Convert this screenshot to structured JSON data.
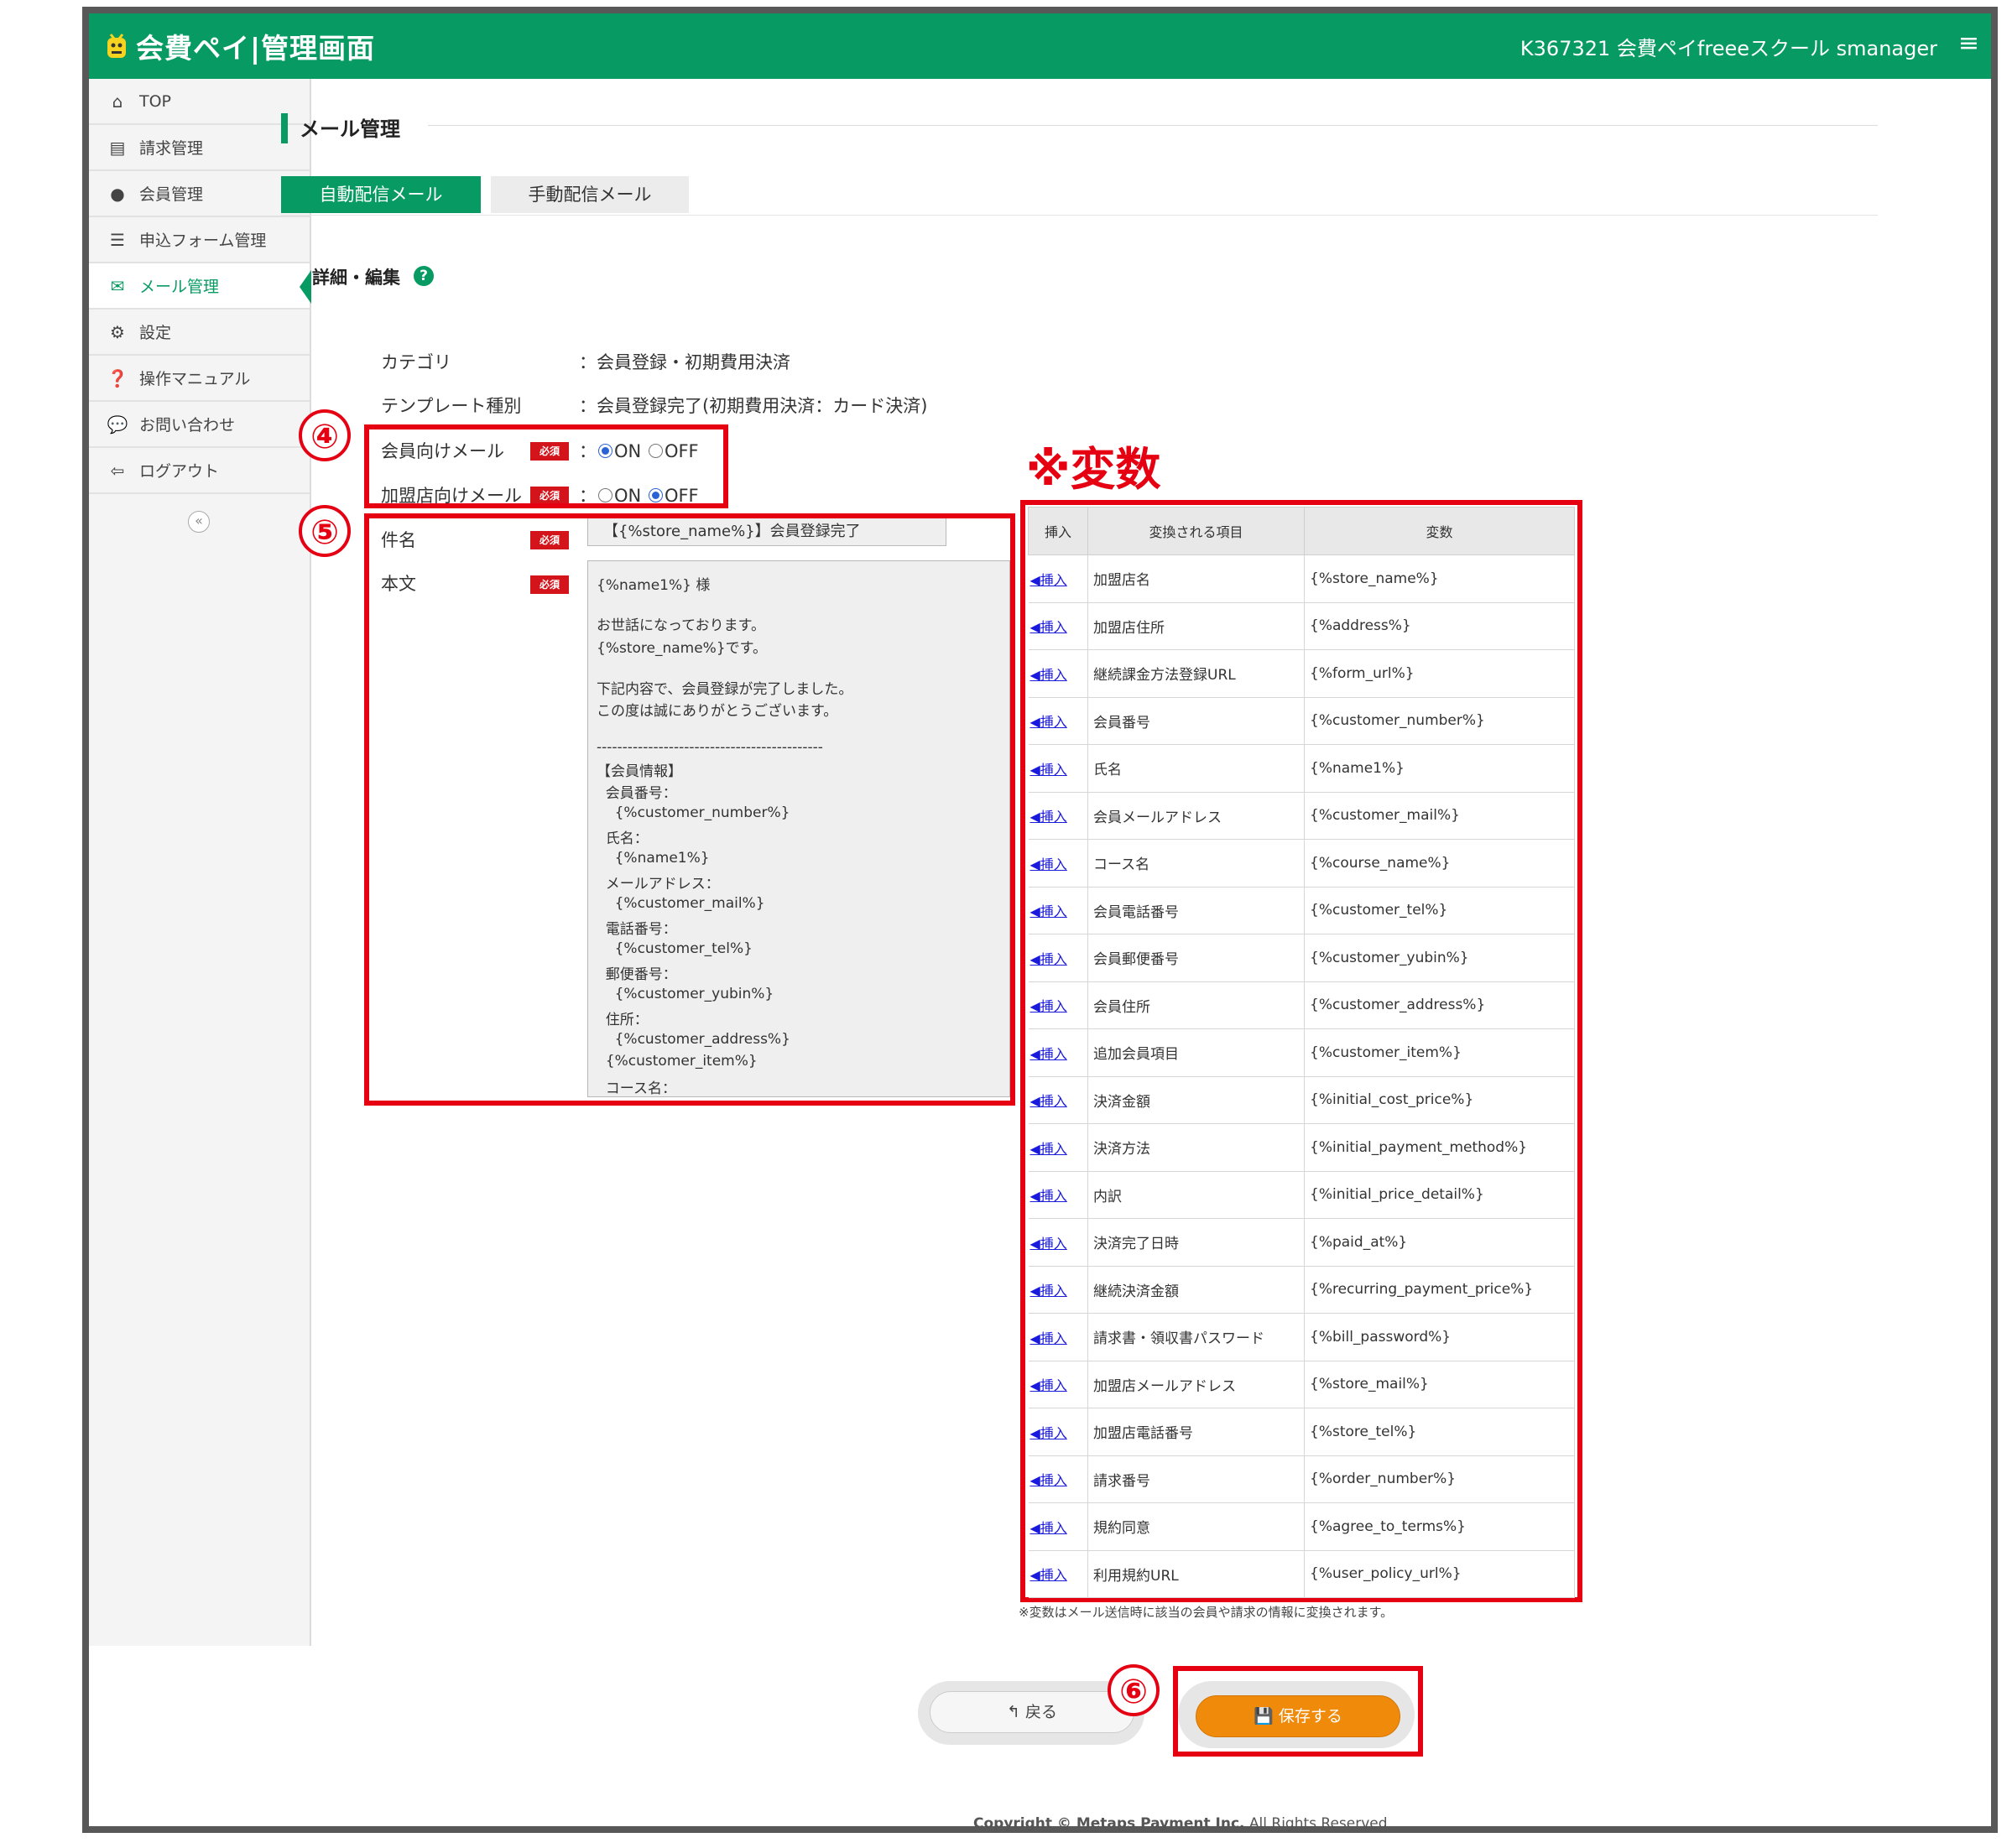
{
  "header": {
    "logo_text": "会費ペイ|管理画面",
    "account": "K367321 会費ペイfreeeスクール smanager",
    "menu_icon": "hamburger-icon"
  },
  "sidebar": {
    "items": [
      {
        "label": "TOP",
        "icon": "home-icon"
      },
      {
        "label": "請求管理",
        "icon": "book-icon"
      },
      {
        "label": "会員管理",
        "icon": "user-icon"
      },
      {
        "label": "申込フォーム管理",
        "icon": "list-icon"
      },
      {
        "label": "メール管理",
        "icon": "mail-icon"
      },
      {
        "label": "設定",
        "icon": "gears-icon"
      },
      {
        "label": "操作マニュアル",
        "icon": "question-icon"
      },
      {
        "label": "お問い合わせ",
        "icon": "chat-icon"
      },
      {
        "label": "ログアウト",
        "icon": "logout-icon"
      }
    ],
    "collapse": "«"
  },
  "main": {
    "page_title": "メール管理",
    "tabs": [
      {
        "label": "自動配信メール"
      },
      {
        "label": "手動配信メール"
      }
    ],
    "section_title": "詳細・編集",
    "help": "?",
    "required_label": "必須",
    "category_label": "カテゴリ",
    "category_value": "：会員登録・初期費用決済",
    "template_label": "テンプレート種別",
    "template_value": "：会員登録完了(初期費用決済：カード決済)",
    "member_mail_label": "会員向けメール",
    "store_mail_label": "加盟店向けメール",
    "colon": "：",
    "on": "ON",
    "off": "OFF",
    "subject_label": "件名",
    "subject_value": "【{%store_name%}】会員登録完了",
    "body_label": "本文",
    "body_lines": [
      "{%name1%} 様",
      "お世話になっております。",
      "{%store_name%}です。",
      "下記内容で、会員登録が完了しました。",
      "この度は誠にありがとうございます。",
      "--------------------------------------------",
      "【会員情報】",
      "  会員番号：",
      "    {%customer_number%}",
      "  氏名：",
      "    {%name1%}",
      "  メールアドレス：",
      "    {%customer_mail%}",
      "  電話番号：",
      "    {%customer_tel%}",
      "  郵便番号：",
      "    {%customer_yubin%}",
      "  住所：",
      "    {%customer_address%}",
      "  {%customer_item%}",
      "  コース名："
    ]
  },
  "annotations": {
    "four": "④",
    "five": "⑤",
    "six": "⑥",
    "var_title": "※変数"
  },
  "var_table": {
    "headers": [
      "挿入",
      "変換される項目",
      "変数"
    ],
    "insert_label": "◀挿入",
    "rows": [
      {
        "item": "加盟店名",
        "var": "{%store_name%}"
      },
      {
        "item": "加盟店住所",
        "var": "{%address%}"
      },
      {
        "item": "継続課金方法登録URL",
        "var": "{%form_url%}"
      },
      {
        "item": "会員番号",
        "var": "{%customer_number%}"
      },
      {
        "item": "氏名",
        "var": "{%name1%}"
      },
      {
        "item": "会員メールアドレス",
        "var": "{%customer_mail%}"
      },
      {
        "item": "コース名",
        "var": "{%course_name%}"
      },
      {
        "item": "会員電話番号",
        "var": "{%customer_tel%}"
      },
      {
        "item": "会員郵便番号",
        "var": "{%customer_yubin%}"
      },
      {
        "item": "会員住所",
        "var": "{%customer_address%}"
      },
      {
        "item": "追加会員項目",
        "var": "{%customer_item%}"
      },
      {
        "item": "決済金額",
        "var": "{%initial_cost_price%}"
      },
      {
        "item": "決済方法",
        "var": "{%initial_payment_method%}"
      },
      {
        "item": "内訳",
        "var": "{%initial_price_detail%}"
      },
      {
        "item": "決済完了日時",
        "var": "{%paid_at%}"
      },
      {
        "item": "継続決済金額",
        "var": "{%recurring_payment_price%}"
      },
      {
        "item": "請求書・領収書パスワード",
        "var": "{%bill_password%}"
      },
      {
        "item": "加盟店メールアドレス",
        "var": "{%store_mail%}"
      },
      {
        "item": "加盟店電話番号",
        "var": "{%store_tel%}"
      },
      {
        "item": "請求番号",
        "var": "{%order_number%}"
      },
      {
        "item": "規約同意",
        "var": "{%agree_to_terms%}"
      },
      {
        "item": "利用規約URL",
        "var": "{%user_policy_url%}"
      }
    ],
    "note": "※変数はメール送信時に該当の会員や請求の情報に変換されます。"
  },
  "buttons": {
    "back": "戻る",
    "save": "保存する"
  },
  "footer": {
    "copyright_bold": "Copyright © Metaps Payment Inc.",
    "copyright_rest": " All Rights Reserved"
  },
  "colors": {
    "brand_green": "#079b63",
    "required_red": "#d4141b",
    "annotation_red": "#e50012",
    "save_orange": "#f08a0a"
  }
}
